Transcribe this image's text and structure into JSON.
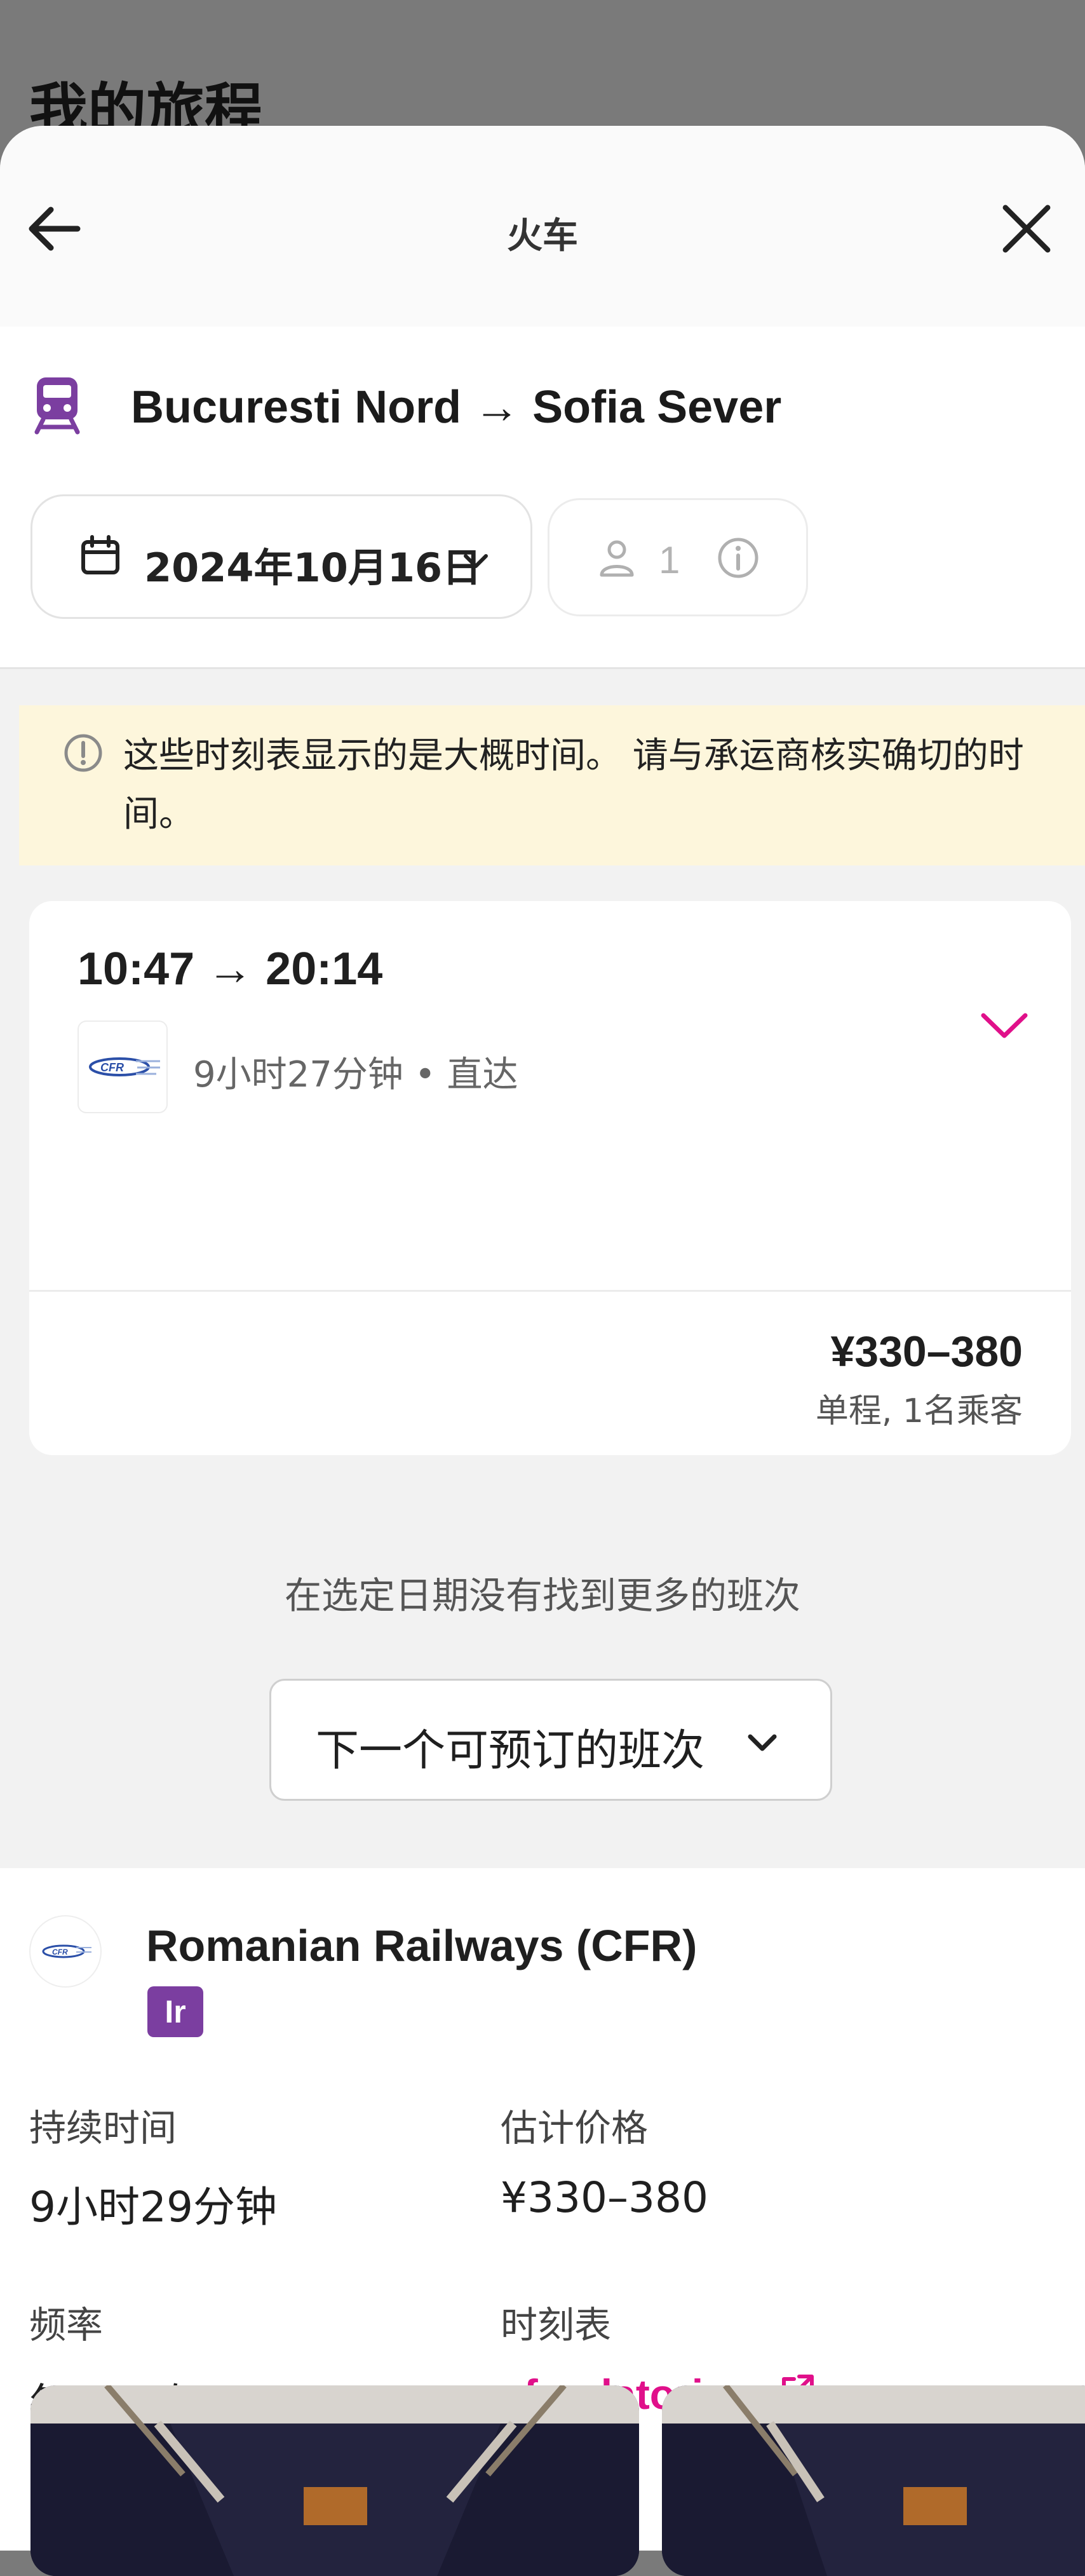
{
  "background": {
    "title": "我的旅程"
  },
  "header": {
    "title": "火车",
    "back_icon": "arrow-left-icon",
    "close_icon": "close-icon"
  },
  "route": {
    "icon": "train-icon",
    "text": "Bucuresti Nord → Sofia Sever"
  },
  "date_picker": {
    "icon": "calendar-icon",
    "value": "2024年10月16日",
    "chevron": "chevron-down-icon"
  },
  "passengers": {
    "icon": "person-icon",
    "count": "1",
    "info_icon": "info-icon"
  },
  "notice": {
    "icon": "warning-icon",
    "text": "这些时刻表显示的是大概时间。 请与承运商核实确切的时间。"
  },
  "trip": {
    "times": "10:47 → 20:14",
    "carrier_logo": "CFR",
    "meta": "9小时27分钟 • 直达",
    "price": "¥330–380",
    "price_note": "单程, 1名乘客"
  },
  "no_more_text": "在选定日期没有找到更多的班次",
  "next_button": {
    "label": "下一个可预订的班次"
  },
  "operator": {
    "name": "Romanian Railways (CFR)",
    "badge": "Ir",
    "duration_label": "持续时间",
    "duration_value": "9小时29分钟",
    "price_label": "估计价格",
    "price_value": "¥330–380",
    "frequency_label": "频率",
    "frequency_value": "每天两次",
    "schedule_label": "时刻表",
    "schedule_link": "cfrcalatori.ro"
  },
  "colors": {
    "accent": "#e0108a",
    "train_icon": "#7b3ea0",
    "notice_bg": "#fdf6dc"
  }
}
